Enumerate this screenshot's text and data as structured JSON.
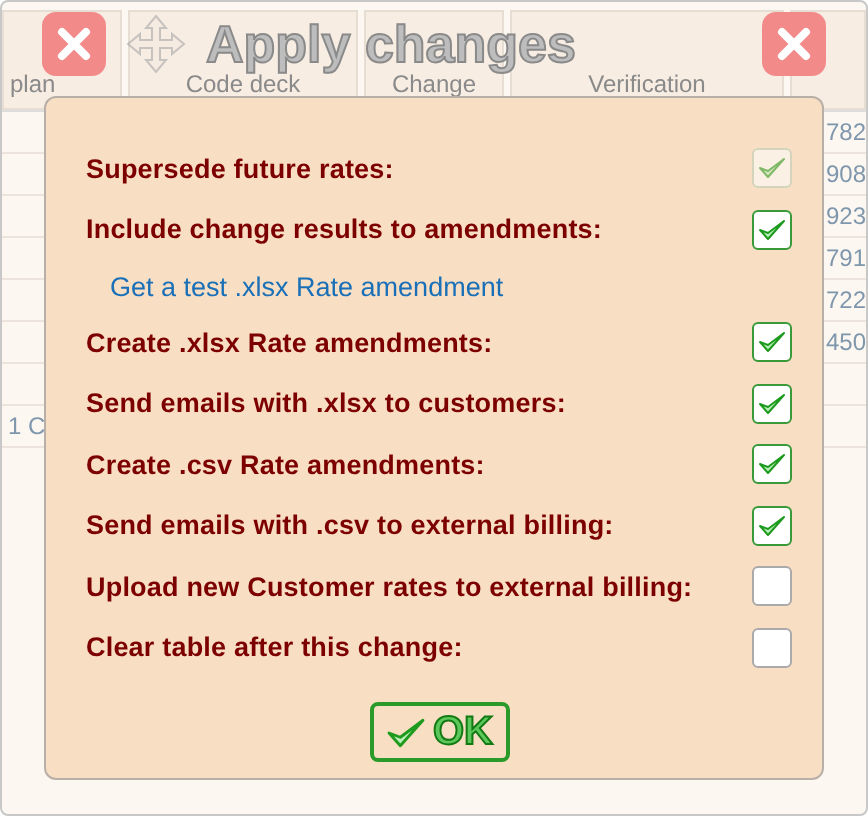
{
  "background_table": {
    "columns": [
      "plan",
      "Code deck",
      "Change",
      "Verification"
    ],
    "rows": [
      {
        "column_1": "",
        "column_5": "782"
      },
      {
        "column_1": "",
        "column_5": "908"
      },
      {
        "column_1": "",
        "column_5": "923"
      },
      {
        "column_1": "",
        "column_5": "791"
      },
      {
        "column_1": "",
        "column_5": "722"
      },
      {
        "column_1": "",
        "column_5": "450"
      },
      {
        "column_1": "",
        "column_5": ""
      },
      {
        "column_1": "1 C",
        "column_5": ""
      }
    ]
  },
  "window": {
    "title": "Apply changes"
  },
  "dialog": {
    "items": [
      {
        "kind": "checkbox",
        "label": "Supersede future rates:",
        "checked": true,
        "disabled": true
      },
      {
        "kind": "checkbox",
        "label": "Include change results to amendments:",
        "checked": true,
        "disabled": false
      },
      {
        "kind": "link",
        "label": "Get a test .xlsx Rate amendment"
      },
      {
        "kind": "checkbox",
        "label": "Create .xlsx Rate amendments:",
        "checked": true,
        "disabled": false
      },
      {
        "kind": "checkbox",
        "label": "Send emails with .xlsx to customers:",
        "checked": true,
        "disabled": false
      },
      {
        "kind": "checkbox",
        "label": "Create .csv Rate amendments:",
        "checked": true,
        "disabled": false
      },
      {
        "kind": "checkbox",
        "label": "Send emails with .csv to external billing:",
        "checked": true,
        "disabled": false
      },
      {
        "kind": "checkbox",
        "label": "Upload new Customer rates to external billing:",
        "checked": false,
        "disabled": false
      },
      {
        "kind": "checkbox",
        "label": "Clear table after this change:",
        "checked": false,
        "disabled": false
      }
    ],
    "ok_button": "OK"
  }
}
